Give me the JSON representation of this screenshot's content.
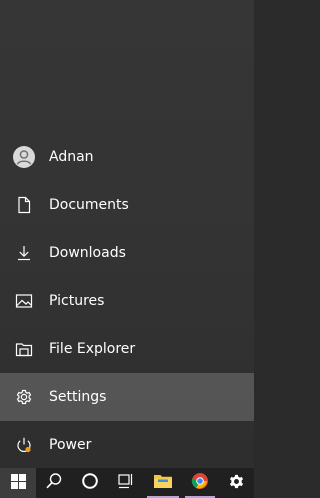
{
  "start_menu": {
    "items": [
      {
        "label": "Adnan",
        "icon": "user-avatar-icon"
      },
      {
        "label": "Documents",
        "icon": "document-icon"
      },
      {
        "label": "Downloads",
        "icon": "download-icon"
      },
      {
        "label": "Pictures",
        "icon": "pictures-icon"
      },
      {
        "label": "File Explorer",
        "icon": "file-explorer-icon"
      },
      {
        "label": "Settings",
        "icon": "gear-icon"
      },
      {
        "label": "Power",
        "icon": "power-icon"
      }
    ],
    "highlighted_item": "Settings"
  },
  "taskbar": {
    "buttons": [
      {
        "name": "start",
        "icon": "windows-logo-icon"
      },
      {
        "name": "search",
        "icon": "search-icon"
      },
      {
        "name": "cortana",
        "icon": "cortana-circle-icon"
      },
      {
        "name": "task-view",
        "icon": "task-view-icon"
      },
      {
        "name": "file-explorer",
        "icon": "folder-icon"
      },
      {
        "name": "chrome",
        "icon": "chrome-icon"
      },
      {
        "name": "settings",
        "icon": "gear-icon"
      }
    ],
    "colors": {
      "accent_underline": "#b9a3d9",
      "windows_logo": "#ffffff",
      "folder": "#f4c542"
    }
  }
}
